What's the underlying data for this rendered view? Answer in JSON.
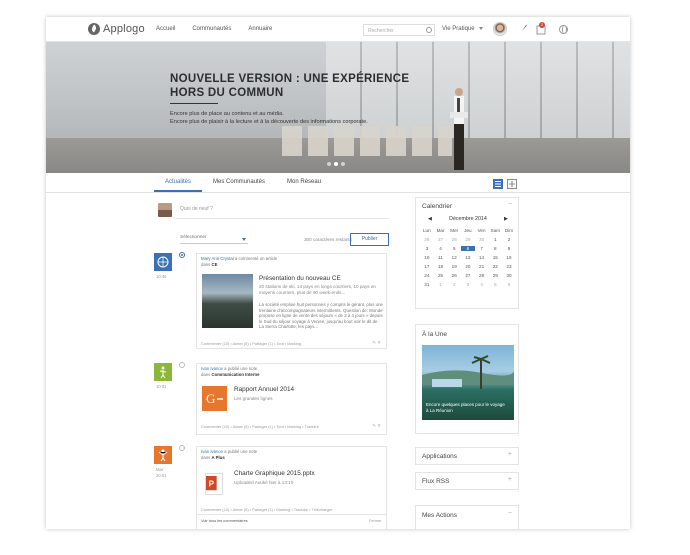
{
  "app": {
    "logo_text": "Applogo"
  },
  "nav": {
    "items": [
      "Accueil",
      "Communautés",
      "Annuaire"
    ]
  },
  "search": {
    "placeholder": "Rechercher"
  },
  "menu": {
    "vie_pratique": "Vie Pratique"
  },
  "notifications": {
    "count": "2"
  },
  "hero": {
    "title": "NOUVELLE VERSION : UNE EXPÉRIENCE HORS DU COMMUN",
    "line1": "Encore plus de place au contenu et au média.",
    "line2": "Encore plus de plaisir à la lecture et à la découverte des informations corporate."
  },
  "tabs": [
    "Actualités",
    "Mes Communautés",
    "Mon Réseau"
  ],
  "composer": {
    "placeholder": "Quoi de neuf ?",
    "select": "Sélectionner",
    "char_count": "300 caractères restants",
    "publish": "Publier"
  },
  "posts": [
    {
      "date": "10:45",
      "author": "Mary Ann Crystal",
      "verb": " a commenté un article",
      "place_prefix": "dans ",
      "place": "CE",
      "title": "Présentation du nouveau CE",
      "desc": "20 stations de ski, 14 pays en longs courriers, 10 pays en moyens courriers, plus de 90 week-ends...",
      "body": "La société emploie huit personnes y compris le gérant, plus une trentaine d'accompagnateurs intermittents. Question de: Monde propose en ligne de vente des séjours « de 2 à 4 jours » depuis le Sud du séjour voyage à Venise, jusqu'au bout voir le dit de La Sierra Charlotte, les pays...",
      "actions": "Commenter (10) • Aimer (5) • Partager (1) • Tout • Marking"
    },
    {
      "date": "10:01",
      "author": "Ivan Ivanov",
      "verb": " a publié une note",
      "place_prefix": "dans ",
      "place": "Communication Interne",
      "title": "Rapport Annuel 2014",
      "desc": "Les grandes lignes",
      "actions": "Commenter (10) • Aimer (5) • Partager (1) • Tout • Marking • Traduire"
    },
    {
      "date_top": "Mar",
      "date": "20:01",
      "author": "Ivan Ivanov",
      "verb": " a publié une note",
      "place_prefix": "dans ",
      "place": "A Plus",
      "title": "Charte Graphique 2015.pptx",
      "desc": "Uploaded Aoukè hier à 13:10",
      "actions": "Commenter (10) • Aimer (5) • Partager (1) • Marking • Traduire • Télécharger",
      "see_all": "Voir tous les commentaires",
      "see_all_right": "Fermer"
    }
  ],
  "calendar": {
    "title": "Calendrier",
    "month": "Décembre 2014",
    "days": [
      "Lun",
      "Mar",
      "Mer",
      "Jeu",
      "Ven",
      "Sam",
      "Dim"
    ],
    "cells": [
      "26",
      "27",
      "28",
      "29",
      "30",
      "1",
      "2",
      "3",
      "4",
      "5",
      "6",
      "7",
      "8",
      "9",
      "10",
      "11",
      "12",
      "13",
      "14",
      "15",
      "16",
      "17",
      "18",
      "19",
      "20",
      "21",
      "22",
      "23",
      "24",
      "25",
      "26",
      "27",
      "28",
      "29",
      "30",
      "31",
      "1",
      "2",
      "3",
      "4",
      "5",
      "6"
    ],
    "today_index": 10
  },
  "une": {
    "title": "À la Une",
    "caption": "Encore quelques places pour le voyage à La Réunion"
  },
  "widgets": {
    "applications": "Applications",
    "flux_rss": "Flux RSS",
    "mes_actions": "Mes Actions"
  },
  "colors": {
    "accent": "#3a70b5",
    "ce_icon": "#3a70b5",
    "note_icon": "#8bb83a",
    "ppt_icon": "#e8772e"
  }
}
